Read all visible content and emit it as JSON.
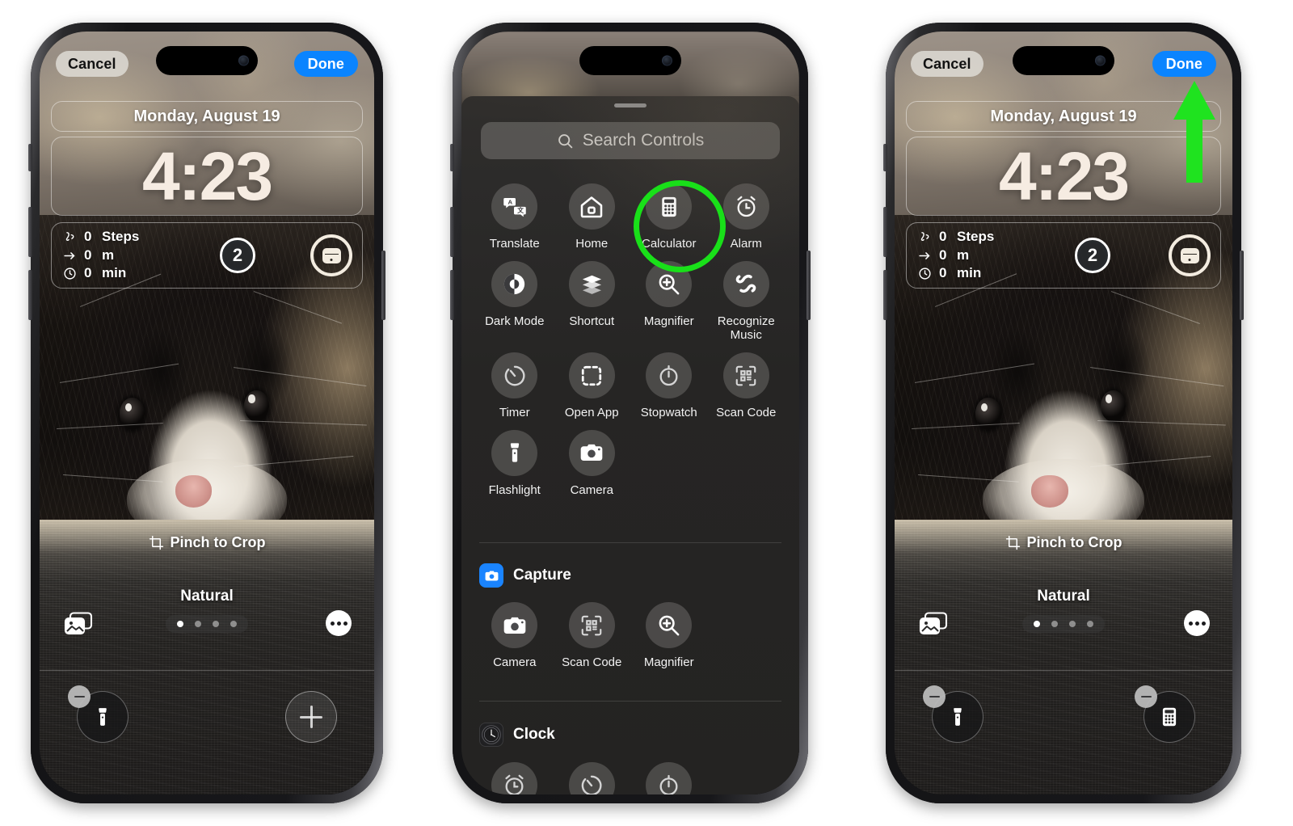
{
  "phones": {
    "left": {
      "name": "lock-screen-editor",
      "topbar": {
        "cancel": "Cancel",
        "done": "Done"
      },
      "date": "Monday, August 19",
      "time": "4:23",
      "widget": {
        "fitness": [
          {
            "icon": "steps-icon",
            "value": "0",
            "unit": "Steps"
          },
          {
            "icon": "distance-icon",
            "value": "0",
            "unit": "m"
          },
          {
            "icon": "time-icon",
            "value": "0",
            "unit": "min"
          }
        ],
        "badge": "2",
        "airpods_icon": "airpods-case-icon"
      },
      "pinch_hint": "Pinch to Crop",
      "style_name": "Natural",
      "dots": {
        "count": 4,
        "active_index": 0
      },
      "left_slot": {
        "icon": "flashlight-icon",
        "state": "filled",
        "remove": "−"
      },
      "right_slot": {
        "icon": "plus-icon",
        "state": "empty"
      }
    },
    "middle": {
      "name": "controls-gallery",
      "search": {
        "placeholder": "Search Controls",
        "icon": "search-icon"
      },
      "rows": [
        [
          {
            "label": "Translate",
            "icon": "translate-icon"
          },
          {
            "label": "Home",
            "icon": "home-icon"
          },
          {
            "label": "Calculator",
            "icon": "calculator-icon",
            "highlighted": true
          },
          {
            "label": "Alarm",
            "icon": "alarm-icon"
          }
        ],
        [
          {
            "label": "Dark Mode",
            "icon": "dark-mode-icon"
          },
          {
            "label": "Shortcut",
            "icon": "shortcut-icon"
          },
          {
            "label": "Magnifier",
            "icon": "magnifier-icon"
          },
          {
            "label": "Recognize Music",
            "icon": "shazam-icon"
          }
        ],
        [
          {
            "label": "Timer",
            "icon": "timer-icon"
          },
          {
            "label": "Open App",
            "icon": "open-app-icon"
          },
          {
            "label": "Stopwatch",
            "icon": "stopwatch-icon"
          },
          {
            "label": "Scan Code",
            "icon": "scan-code-icon"
          }
        ],
        [
          {
            "label": "Flashlight",
            "icon": "flashlight-icon"
          },
          {
            "label": "Camera",
            "icon": "camera-icon"
          }
        ]
      ],
      "sections": [
        {
          "title": "Capture",
          "icon": "capture-app-icon",
          "items": [
            {
              "label": "Camera",
              "icon": "camera-icon"
            },
            {
              "label": "Scan Code",
              "icon": "scan-code-icon"
            },
            {
              "label": "Magnifier",
              "icon": "magnifier-icon"
            }
          ]
        },
        {
          "title": "Clock",
          "icon": "clock-app-icon",
          "items": [
            {
              "label": "",
              "icon": "alarm-icon"
            },
            {
              "label": "",
              "icon": "timer-icon"
            },
            {
              "label": "",
              "icon": "stopwatch-icon"
            }
          ]
        }
      ],
      "highlight_color": "#19e019"
    },
    "right": {
      "name": "lock-screen-editor-after",
      "topbar": {
        "cancel": "Cancel",
        "done": "Done"
      },
      "date": "Monday, August 19",
      "time": "4:23",
      "widget": {
        "fitness": [
          {
            "icon": "steps-icon",
            "value": "0",
            "unit": "Steps"
          },
          {
            "icon": "distance-icon",
            "value": "0",
            "unit": "m"
          },
          {
            "icon": "time-icon",
            "value": "0",
            "unit": "min"
          }
        ],
        "badge": "2",
        "airpods_icon": "airpods-case-icon"
      },
      "pinch_hint": "Pinch to Crop",
      "style_name": "Natural",
      "dots": {
        "count": 4,
        "active_index": 0
      },
      "left_slot": {
        "icon": "flashlight-icon",
        "state": "filled",
        "remove": "−"
      },
      "right_slot": {
        "icon": "calculator-icon",
        "state": "filled",
        "remove": "−"
      },
      "annotation": {
        "type": "arrow-up",
        "color": "#1fe31f",
        "points_to": "done-button"
      }
    }
  }
}
